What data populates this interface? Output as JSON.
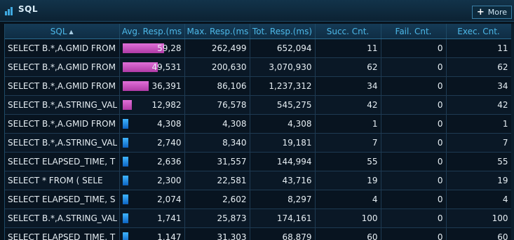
{
  "panel": {
    "title": "SQL",
    "more_label": "More"
  },
  "columns": [
    "SQL",
    "Avg. Resp.(ms",
    "Max. Resp.(ms",
    "Tot. Resp.(ms)",
    "Succ. Cnt.",
    "Fail. Cnt.",
    "Exec. Cnt."
  ],
  "rows": [
    {
      "sql": "SELECT B.*,A.GMID FROM",
      "avg": "59,28",
      "avg_fraction": 0.98,
      "max": "262,499",
      "tot": "652,094",
      "succ": "11",
      "fail": "0",
      "exec": "11"
    },
    {
      "sql": "SELECT B.*,A.GMID FROM",
      "avg": "49,531",
      "avg_fraction": 0.84,
      "max": "200,630",
      "tot": "3,070,930",
      "succ": "62",
      "fail": "0",
      "exec": "62"
    },
    {
      "sql": "SELECT B.*,A.GMID FROM",
      "avg": "36,391",
      "avg_fraction": 0.61,
      "max": "86,106",
      "tot": "1,237,312",
      "succ": "34",
      "fail": "0",
      "exec": "34"
    },
    {
      "sql": "SELECT B.*,A.STRING_VAL",
      "avg": "12,982",
      "avg_fraction": 0.22,
      "max": "76,578",
      "tot": "545,275",
      "succ": "42",
      "fail": "0",
      "exec": "42"
    },
    {
      "sql": "SELECT B.*,A.GMID FROM",
      "avg": "4,308",
      "avg_fraction": 0.07,
      "max": "4,308",
      "tot": "4,308",
      "succ": "1",
      "fail": "0",
      "exec": "1"
    },
    {
      "sql": "SELECT B.*,A.STRING_VAL",
      "avg": "2,740",
      "avg_fraction": 0.05,
      "max": "8,340",
      "tot": "19,181",
      "succ": "7",
      "fail": "0",
      "exec": "7"
    },
    {
      "sql": "SELECT ELAPSED_TIME, T",
      "avg": "2,636",
      "avg_fraction": 0.04,
      "max": "31,557",
      "tot": "144,994",
      "succ": "55",
      "fail": "0",
      "exec": "55"
    },
    {
      "sql": "SELECT * FROM (     SELE",
      "avg": "2,300",
      "avg_fraction": 0.04,
      "max": "22,581",
      "tot": "43,716",
      "succ": "19",
      "fail": "0",
      "exec": "19"
    },
    {
      "sql": "SELECT ELAPSED_TIME, S",
      "avg": "2,074",
      "avg_fraction": 0.03,
      "max": "2,602",
      "tot": "8,297",
      "succ": "4",
      "fail": "0",
      "exec": "4"
    },
    {
      "sql": "SELECT B.*,A.STRING_VAL",
      "avg": "1,741",
      "avg_fraction": 0.03,
      "max": "25,873",
      "tot": "174,161",
      "succ": "100",
      "fail": "0",
      "exec": "100"
    },
    {
      "sql": "SELECT ELAPSED_TIME, T",
      "avg": "1,147",
      "avg_fraction": 0.02,
      "max": "31,303",
      "tot": "68,879",
      "succ": "60",
      "fail": "0",
      "exec": "60"
    }
  ],
  "colors": {
    "bar_high": "#d25ccb",
    "bar_low": "#1f8be0",
    "header_text": "#4db8e8"
  }
}
